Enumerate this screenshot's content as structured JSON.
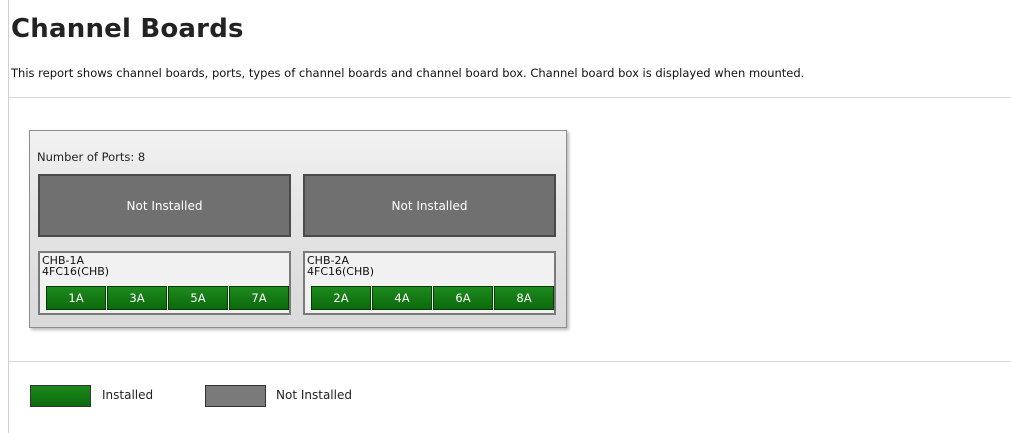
{
  "page": {
    "title": "Channel Boards",
    "description": "This report shows channel boards, ports, types of channel boards and channel board box. Channel board box is displayed when mounted."
  },
  "board_box": {
    "ports_label": "Number of Ports: 8",
    "slots": [
      {
        "status": "Not Installed"
      },
      {
        "status": "Not Installed"
      }
    ],
    "boards": [
      {
        "name": "CHB-1A",
        "type": "4FC16(CHB)",
        "ports": [
          "1A",
          "3A",
          "5A",
          "7A"
        ]
      },
      {
        "name": "CHB-2A",
        "type": "4FC16(CHB)",
        "ports": [
          "2A",
          "4A",
          "6A",
          "8A"
        ]
      }
    ]
  },
  "legend": {
    "installed_label": "Installed",
    "not_installed_label": "Not Installed",
    "installed_color": "#0c6a0c",
    "not_installed_color": "#7a7a7a"
  }
}
